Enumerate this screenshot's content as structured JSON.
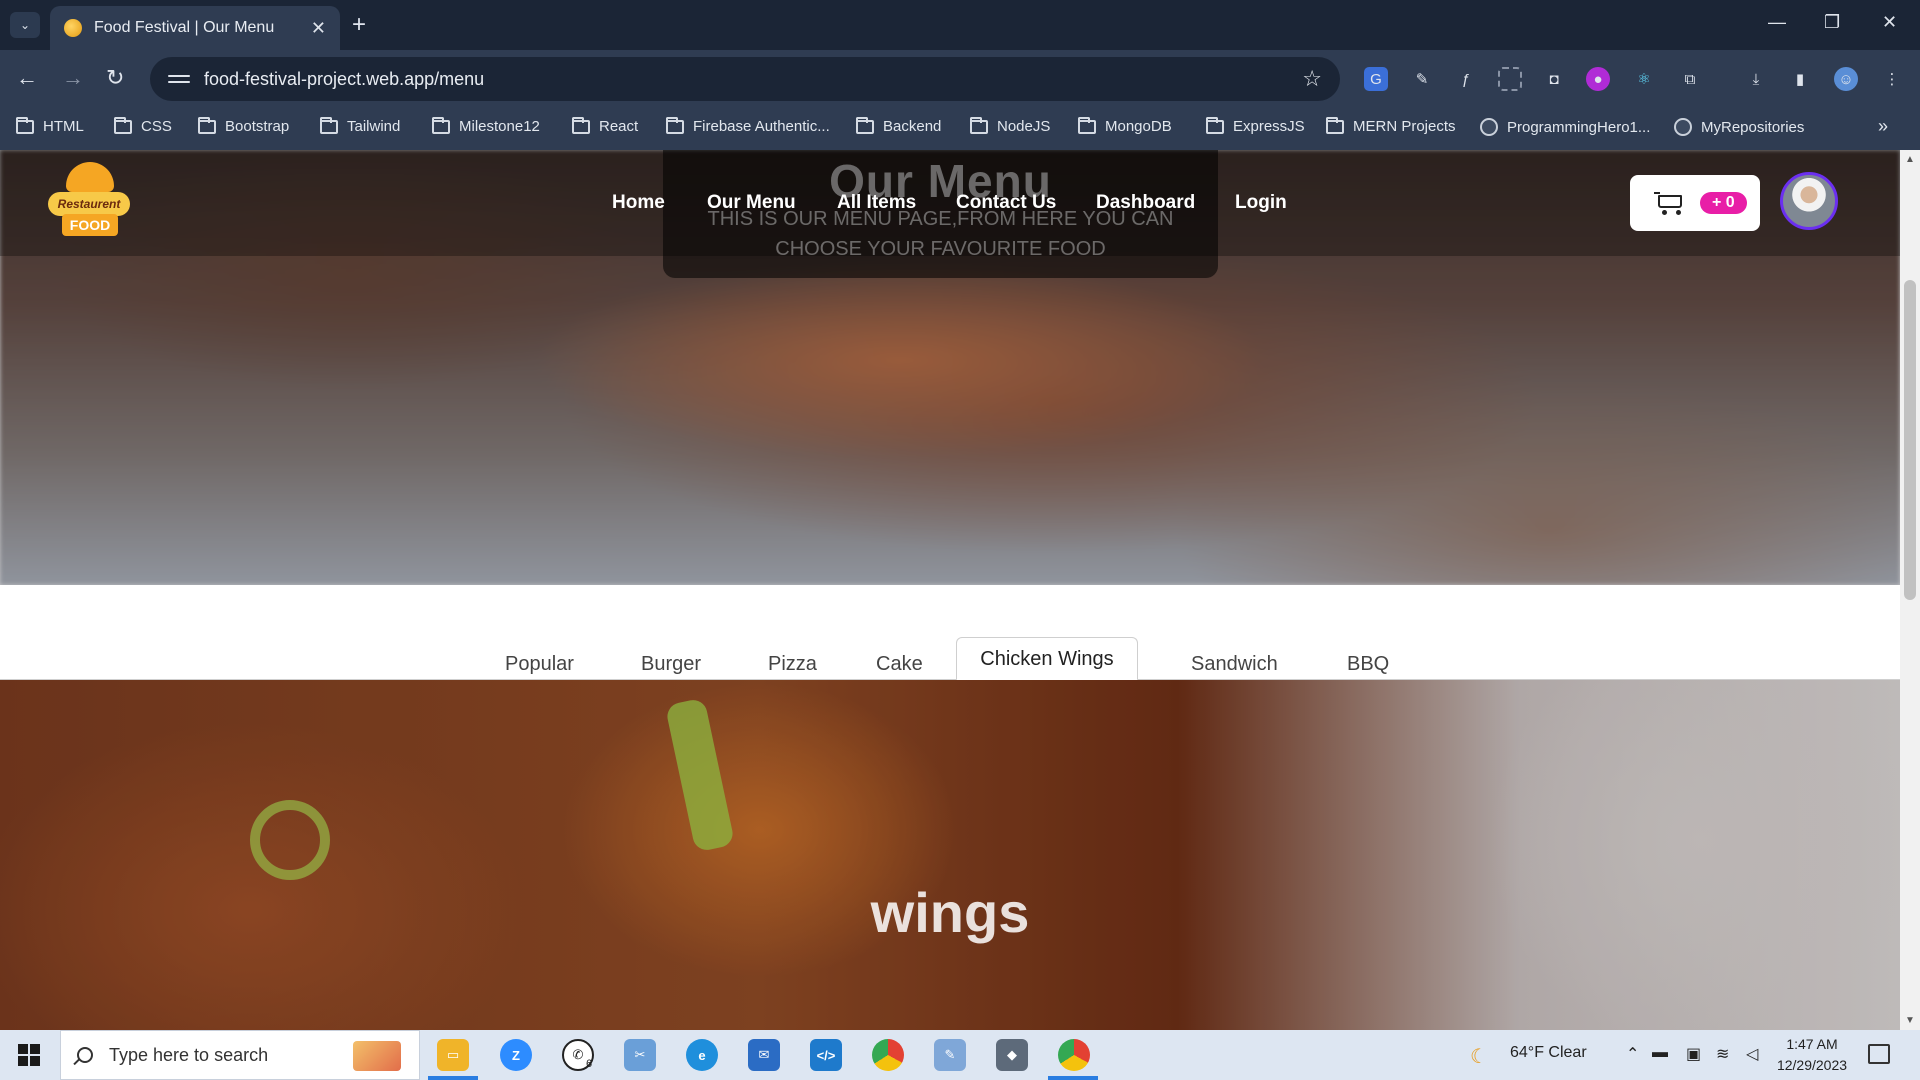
{
  "browser": {
    "tab_title": "Food Festival | Our Menu",
    "tab_close": "✕",
    "new_tab": "+",
    "url": "food-festival-project.web.app/menu",
    "bookmarks": [
      "HTML",
      "CSS",
      "Bootstrap",
      "Tailwind",
      "Milestone12",
      "React",
      "Firebase Authentic...",
      "Backend",
      "NodeJS",
      "MongoDB",
      "ExpressJS",
      "MERN Projects",
      "ProgrammingHero1...",
      "MyRepositories"
    ],
    "window_controls": [
      "—",
      "❐",
      "✕"
    ]
  },
  "site": {
    "logo": {
      "top": "Restaurent",
      "bottom": "FOOD"
    },
    "nav": [
      "Home",
      "Our Menu",
      "All Items",
      "Contact Us",
      "Dashboard",
      "Login"
    ],
    "cart_count": "+ 0",
    "hero": {
      "title": "Our Menu",
      "subtitle": "THIS IS OUR MENU PAGE,FROM HERE YOU CAN CHOOSE YOUR FAVOURITE FOOD"
    },
    "tabs": [
      "Popular",
      "Burger",
      "Pizza",
      "Cake",
      "Chicken Wings",
      "Sandwich",
      "BBQ"
    ],
    "active_tab": "Chicken Wings",
    "section_heading": "wings"
  },
  "taskbar": {
    "search_placeholder": "Type here to search",
    "whatsapp_badge": "6",
    "weather": "64°F  Clear",
    "time": "1:47 AM",
    "date": "12/29/2023"
  },
  "colors": {
    "browser_dark": "#1b2536",
    "browser_toolbar": "#2f3c52",
    "cart_badge": "#e81ea7",
    "avatar_ring": "#6b2ff0",
    "taskbar": "#dde6f2"
  }
}
